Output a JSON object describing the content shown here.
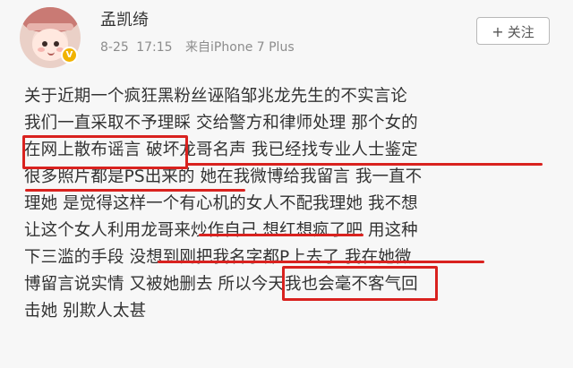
{
  "post": {
    "username": "孟凯绮",
    "date": "8-25",
    "time": "17:15",
    "source": "来自iPhone 7 Plus",
    "follow_label": "关注",
    "lines": [
      "关于近期一个疯狂黑粉丝诬陷邹兆龙先生的不实言论",
      "我们一直采取不予理睬 交给警方和律师处理 那个女的",
      "在网上散布谣言 破坏龙哥名声 我已经找专业人士鉴定",
      "很多照片都是PS出来的 她在我微博给我留言 我一直不",
      "理她 是觉得这样一个有心机的女人不配我理她 我不想",
      "让这个女人利用龙哥来炒作自己 想红想疯了吧 用这种",
      "下三滥的手段 没想到刚把我名字都P上去了 我在她微",
      "博留言说实情 又被她删去 所以今天我也会毫不客气回",
      "击她 别欺人太甚"
    ]
  },
  "icons": {
    "follow": "plus-icon",
    "verified": "verified-badge-icon"
  },
  "colors": {
    "annotation": "#d9221f",
    "meta": "#8c8c8c",
    "text": "#333333"
  }
}
